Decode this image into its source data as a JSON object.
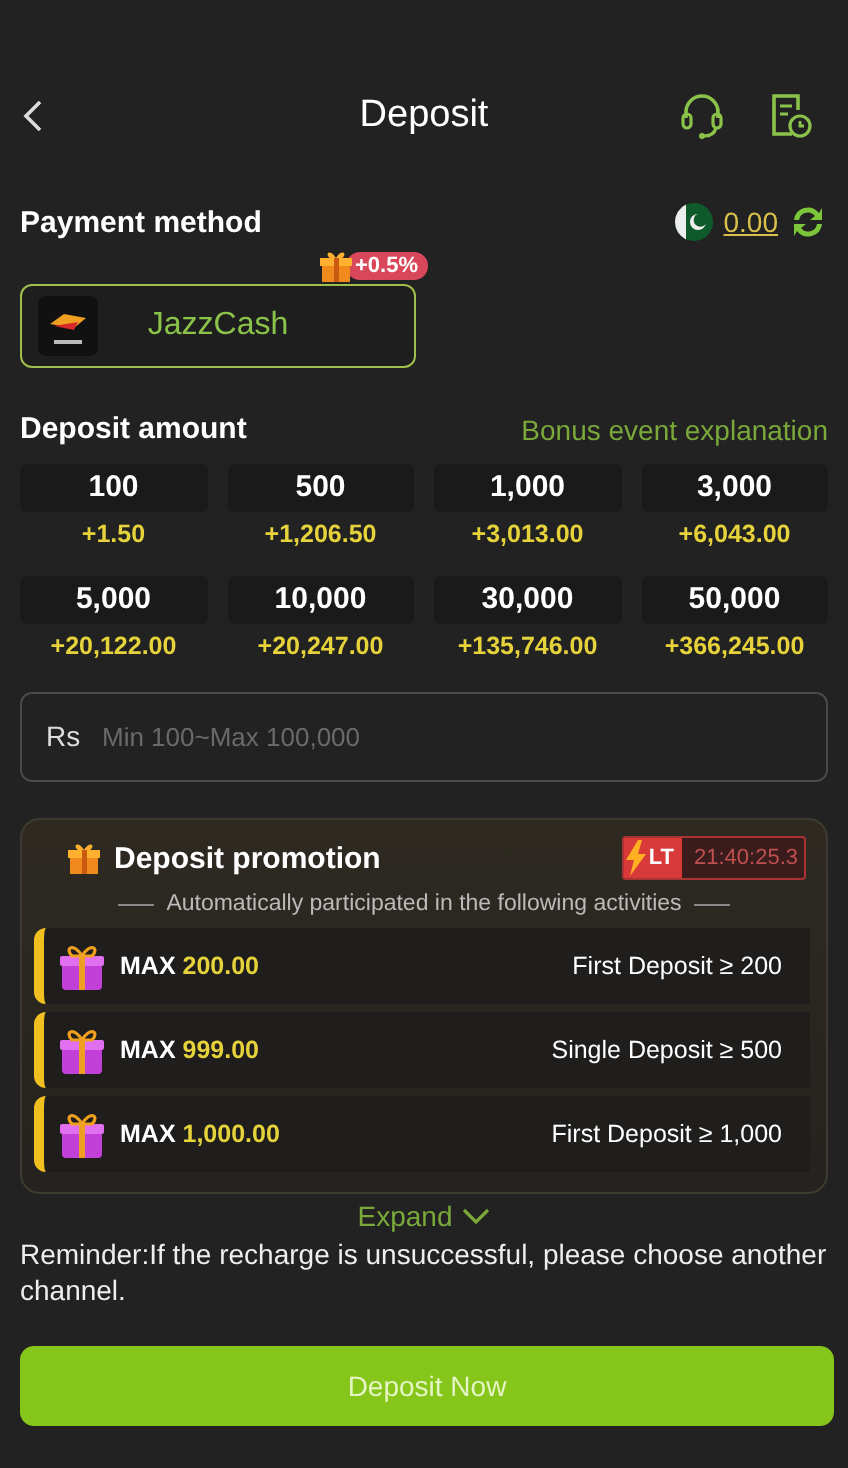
{
  "header": {
    "title": "Deposit"
  },
  "payment": {
    "label": "Payment method",
    "balance": "0.00",
    "methods": [
      {
        "name": "JazzCash",
        "bonus": "+0.5%",
        "selected": true
      }
    ]
  },
  "amount": {
    "label": "Deposit amount",
    "link": "Bonus event explanation",
    "options": [
      {
        "amount": "100",
        "bonus": "+1.50"
      },
      {
        "amount": "500",
        "bonus": "+1,206.50"
      },
      {
        "amount": "1,000",
        "bonus": "+3,013.00"
      },
      {
        "amount": "3,000",
        "bonus": "+6,043.00"
      },
      {
        "amount": "5,000",
        "bonus": "+20,122.00"
      },
      {
        "amount": "10,000",
        "bonus": "+20,247.00"
      },
      {
        "amount": "30,000",
        "bonus": "+135,746.00"
      },
      {
        "amount": "50,000",
        "bonus": "+366,245.00"
      }
    ],
    "input": {
      "prefix": "Rs",
      "placeholder": "Min 100~Max 100,000"
    }
  },
  "promotion": {
    "title": "Deposit promotion",
    "badge": "LT",
    "timer": "21:40:25.3",
    "subtitle": "Automatically participated in the following activities",
    "items": [
      {
        "max_label": "MAX",
        "max": "200.00",
        "condition": "First Deposit ≥ 200"
      },
      {
        "max_label": "MAX",
        "max": "999.00",
        "condition": "Single Deposit ≥ 500"
      },
      {
        "max_label": "MAX",
        "max": "1,000.00",
        "condition": "First Deposit ≥ 1,000"
      }
    ],
    "expand": "Expand"
  },
  "reminder": "Reminder:If the recharge is unsuccessful, please choose another channel.",
  "submit": "Deposit Now"
}
